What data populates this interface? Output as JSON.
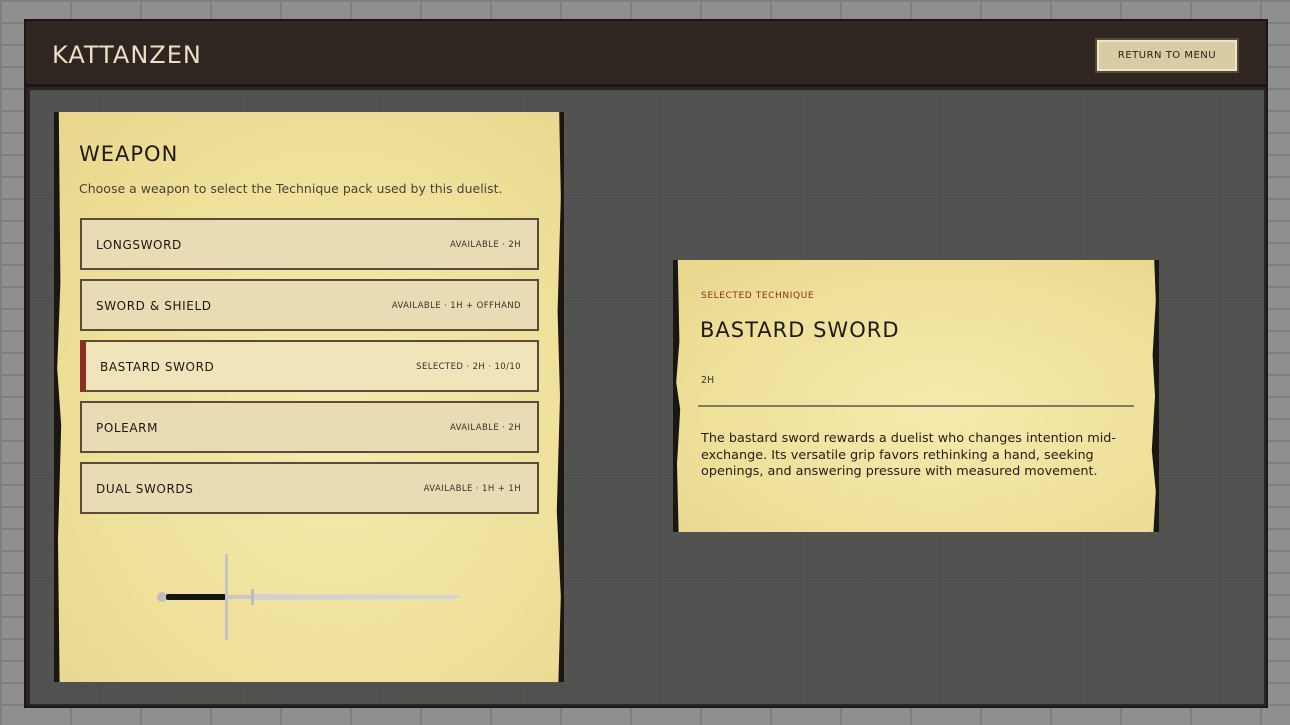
{
  "header": {
    "brand": "KATTANZEN",
    "menu_button": "RETURN TO MENU"
  },
  "weapon_panel": {
    "title": "WEAPON",
    "description": "Choose a weapon to select the Technique pack used by this duelist.",
    "items": [
      {
        "name": "LONGSWORD",
        "meta": "AVAILABLE  ·  2H",
        "state": "available"
      },
      {
        "name": "SWORD & SHIELD",
        "meta": "AVAILABLE  ·  1H + OFFHAND",
        "state": "available"
      },
      {
        "name": "BASTARD SWORD",
        "meta": "SELECTED  ·  2H  ·  10/10",
        "state": "selected"
      },
      {
        "name": "POLEARM",
        "meta": "AVAILABLE  ·  2H",
        "state": "available"
      },
      {
        "name": "DUAL SWORDS",
        "meta": "AVAILABLE  ·  1H + 1H",
        "state": "available"
      }
    ],
    "preview_icon": "bastard-sword-icon"
  },
  "technique_panel": {
    "label": "SELECTED TECHNIQUE",
    "title": "BASTARD SWORD",
    "hands": "2H",
    "description": "The bastard sword rewards a duelist who changes intention mid-exchange. Its versatile grip favors rethinking a hand, seeking openings, and answering pressure with measured movement."
  },
  "colors": {
    "frame": "#2f2622",
    "stage": "#525250",
    "parchment": "#efe09a",
    "accent": "#8b2f22"
  }
}
